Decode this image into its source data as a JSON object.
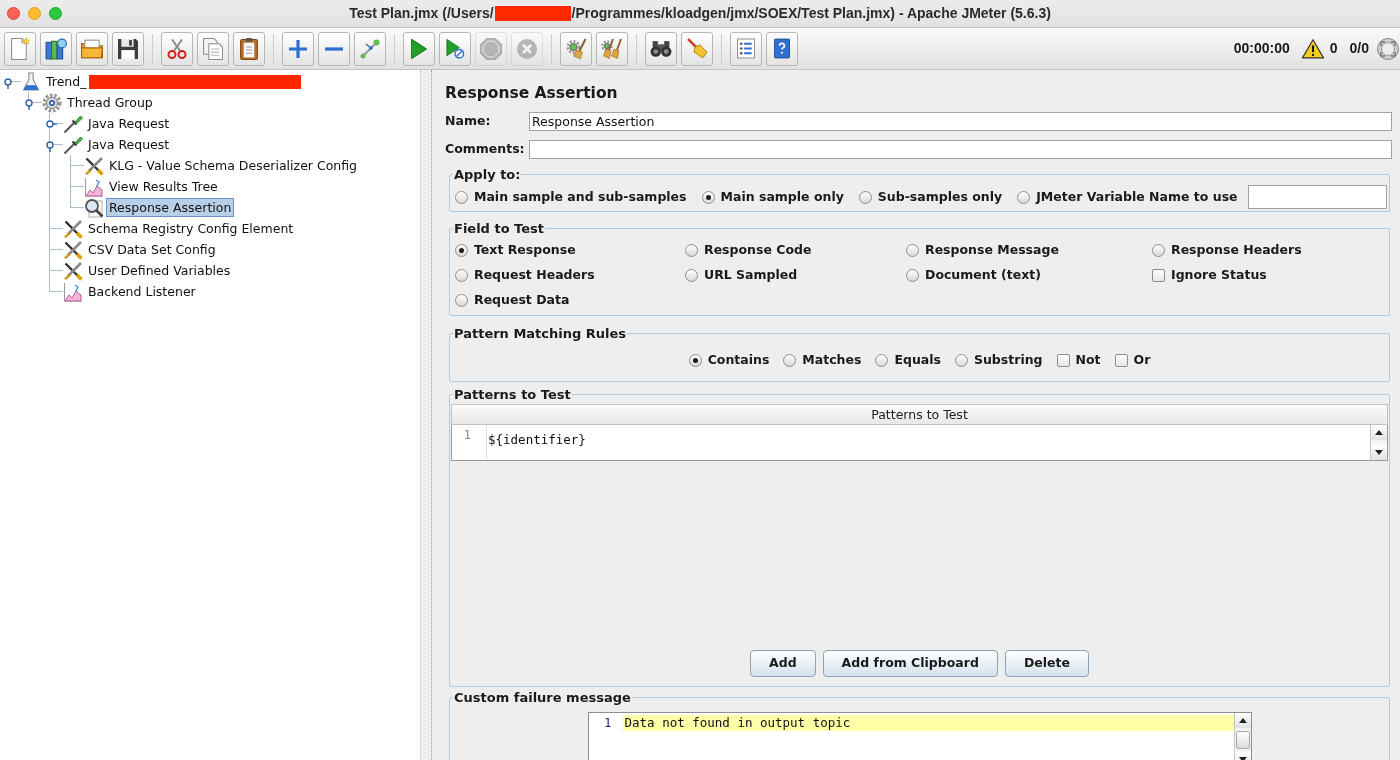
{
  "window": {
    "title_parts": [
      "Test Plan.jmx (/Users/",
      "/Programmes/kloadgen/jmx/SOEX/Test Plan.jmx) - Apache JMeter (5.6.3)"
    ]
  },
  "toolbar": {
    "groups": [
      [
        {
          "kind": "new",
          "disabled": false
        },
        {
          "kind": "templates",
          "disabled": false
        },
        {
          "kind": "open",
          "disabled": false
        },
        {
          "kind": "save",
          "disabled": false
        }
      ],
      [
        {
          "kind": "cut",
          "disabled": false
        },
        {
          "kind": "copy",
          "disabled": false
        },
        {
          "kind": "paste",
          "disabled": false
        }
      ],
      [
        {
          "kind": "expand",
          "disabled": false
        },
        {
          "kind": "collapse",
          "disabled": false
        },
        {
          "kind": "toggle",
          "disabled": false
        }
      ],
      [
        {
          "kind": "start",
          "disabled": false
        },
        {
          "kind": "start-no-pauses",
          "disabled": false
        },
        {
          "kind": "stop",
          "disabled": true
        },
        {
          "kind": "shutdown",
          "disabled": true
        }
      ],
      [
        {
          "kind": "clear",
          "disabled": false
        },
        {
          "kind": "clear-all",
          "disabled": false
        }
      ],
      [
        {
          "kind": "search",
          "disabled": false
        },
        {
          "kind": "reset-search",
          "disabled": false
        }
      ],
      [
        {
          "kind": "function-helper",
          "disabled": false
        },
        {
          "kind": "help",
          "disabled": false
        }
      ]
    ],
    "elapsed_time": "00:00:00",
    "error_count": "0",
    "thread_count": "0/0"
  },
  "tree": {
    "items": [
      {
        "label": "Trend_",
        "kind": "test-plan",
        "redacted": true,
        "selected": false,
        "expanded": true,
        "children": [
          {
            "label": "Thread Group",
            "kind": "thread-group",
            "selected": false,
            "expanded": true,
            "children": [
              {
                "label": "Java Request",
                "kind": "sampler",
                "selected": false,
                "expanded": false
              },
              {
                "label": "Java Request",
                "kind": "sampler",
                "selected": false,
                "expanded": true,
                "children": [
                  {
                    "label": "KLG - Value Schema Deserializer Config",
                    "kind": "config",
                    "selected": false
                  },
                  {
                    "label": "View Results Tree",
                    "kind": "listener",
                    "selected": false
                  },
                  {
                    "label": "Response Assertion",
                    "kind": "assertion",
                    "selected": true
                  }
                ]
              },
              {
                "label": "Schema Registry Config Element",
                "kind": "config",
                "selected": false
              },
              {
                "label": "CSV Data Set Config",
                "kind": "config",
                "selected": false
              },
              {
                "label": "User Defined Variables",
                "kind": "config",
                "selected": false
              },
              {
                "label": "Backend Listener",
                "kind": "listener",
                "selected": false
              }
            ]
          }
        ]
      }
    ]
  },
  "element": {
    "title": "Response Assertion",
    "name": {
      "label": "Name:",
      "value": "Response Assertion"
    },
    "comments": {
      "label": "Comments:"
    },
    "apply_to": {
      "legend": "Apply to:",
      "options": [
        {
          "label": "Main sample and sub-samples",
          "selected": false
        },
        {
          "label": "Main sample only",
          "selected": true
        },
        {
          "label": "Sub-samples only",
          "selected": false
        },
        {
          "label": "JMeter Variable Name to use",
          "selected": false
        }
      ]
    },
    "field_to_test": {
      "legend": "Field to Test",
      "options": [
        {
          "kind": "radio",
          "label": "Text Response",
          "selected": true
        },
        {
          "kind": "radio",
          "label": "Response Code",
          "selected": false
        },
        {
          "kind": "radio",
          "label": "Response Message",
          "selected": false
        },
        {
          "kind": "radio",
          "label": "Response Headers",
          "selected": false
        },
        {
          "kind": "radio",
          "label": "Request Headers",
          "selected": false
        },
        {
          "kind": "radio",
          "label": "URL Sampled",
          "selected": false
        },
        {
          "kind": "radio",
          "label": "Document (text)",
          "selected": false
        },
        {
          "kind": "checkbox",
          "label": "Ignore Status",
          "checked": false
        },
        {
          "kind": "radio",
          "label": "Request Data",
          "selected": false
        }
      ]
    },
    "pattern_matching_rules": {
      "legend": "Pattern Matching Rules",
      "options": [
        {
          "kind": "radio",
          "label": "Contains",
          "selected": true
        },
        {
          "kind": "radio",
          "label": "Matches",
          "selected": false
        },
        {
          "kind": "radio",
          "label": "Equals",
          "selected": false
        },
        {
          "kind": "radio",
          "label": "Substring",
          "selected": false
        },
        {
          "kind": "checkbox",
          "label": "Not",
          "checked": false
        },
        {
          "kind": "checkbox",
          "label": "Or",
          "checked": false
        }
      ]
    },
    "patterns_to_test": {
      "legend": "Patterns to Test",
      "column": "Patterns to Test",
      "rows": [
        {
          "line": "1",
          "pattern": "${identifier}"
        }
      ],
      "buttons": [
        "Add",
        "Add from Clipboard",
        "Delete"
      ]
    },
    "custom_failure_message": {
      "legend": "Custom failure message",
      "lines": [
        {
          "line": "1",
          "text": "Data not found in output topic",
          "highlighted": true
        }
      ]
    }
  }
}
